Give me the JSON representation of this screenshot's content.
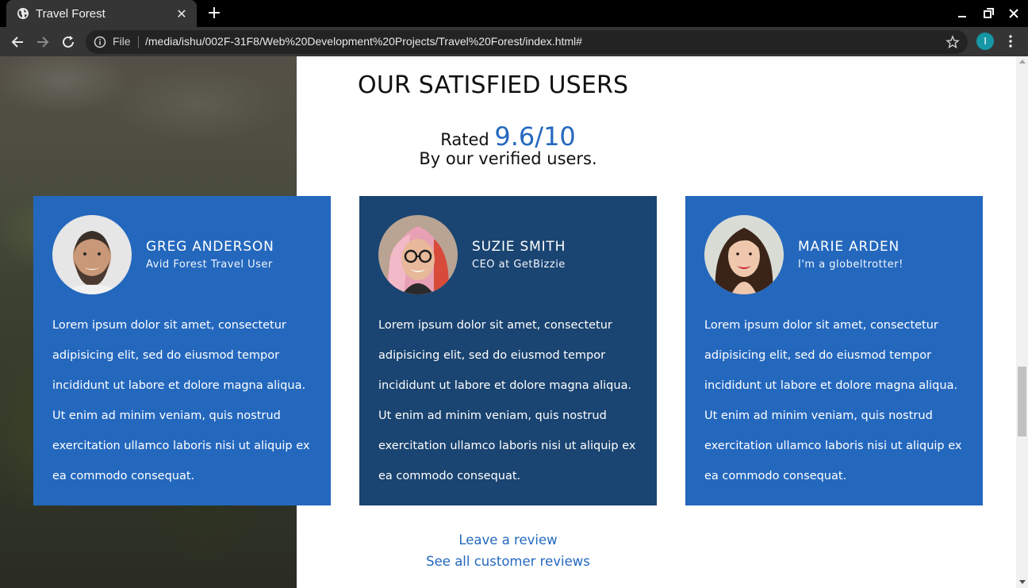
{
  "browser": {
    "tab_title": "Travel Forest",
    "url_scheme_label": "File",
    "url": "/media/ishu/002F-31F8/Web%20Development%20Projects/Travel%20Forest/index.html#",
    "profile_initial": "I"
  },
  "section": {
    "title": "OUR SATISFIED USERS",
    "rated_prefix": "Rated",
    "rating": "9.6/10",
    "subtitle": "By our verified users."
  },
  "testimonials": [
    {
      "name": "GREG ANDERSON",
      "role": "Avid Forest Travel User",
      "quote": "Lorem ipsum dolor sit amet, consectetur adipisicing elit, sed do eiusmod tempor incididunt ut labore et dolore magna aliqua. Ut enim ad minim veniam, quis nostrud exercitation ullamco laboris nisi ut aliquip ex ea commodo consequat.",
      "card_color": "#2468be"
    },
    {
      "name": "SUZIE SMITH",
      "role": "CEO at GetBizzie",
      "quote": "Lorem ipsum dolor sit amet, consectetur adipisicing elit, sed do eiusmod tempor incididunt ut labore et dolore magna aliqua. Ut enim ad minim veniam, quis nostrud exercitation ullamco laboris nisi ut aliquip ex ea commodo consequat.",
      "card_color": "#1a4471"
    },
    {
      "name": "MARIE ARDEN",
      "role": "I'm a globeltrotter!",
      "quote": "Lorem ipsum dolor sit amet, consectetur adipisicing elit, sed do eiusmod tempor incididunt ut labore et dolore magna aliqua. Ut enim ad minim veniam, quis nostrud exercitation ullamco laboris nisi ut aliquip ex ea commodo consequat.",
      "card_color": "#2468be"
    }
  ],
  "links": {
    "leave_review": "Leave a review",
    "see_all": "See all customer reviews"
  },
  "colors": {
    "accent": "#2468be",
    "card_dark": "#1a4471"
  }
}
